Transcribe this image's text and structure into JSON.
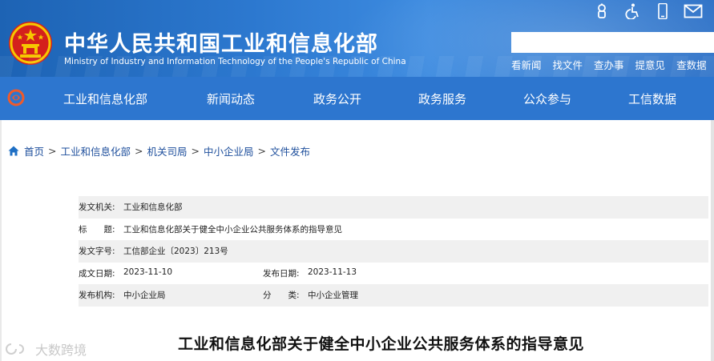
{
  "header": {
    "site_title": "中华人民共和国工业和信息化部",
    "site_subtitle": "Ministry of Industry and Information Technology of the People's Republic of China",
    "top_icons": [
      "robot-icon",
      "accessibility-icon",
      "mobile-icon",
      "mail-icon"
    ],
    "search": {
      "value": "",
      "placeholder": ""
    },
    "quick_links": [
      "看新闻",
      "找文件",
      "查办事",
      "提意见",
      "查数据"
    ]
  },
  "nav": {
    "items": [
      "工业和信息化部",
      "新闻动态",
      "政务公开",
      "政务服务",
      "公众参与",
      "工信数据"
    ]
  },
  "breadcrumb": {
    "items": [
      "首页",
      "工业和信息化部",
      "机关司局",
      "中小企业局",
      "文件发布"
    ],
    "separator": ">"
  },
  "meta": {
    "issuer": {
      "label": "发文机关:",
      "value": "工业和信息化部"
    },
    "title": {
      "label": "标　　题:",
      "value": "工业和信息化部关于健全中小企业公共服务体系的指导意见"
    },
    "doc_number": {
      "label": "发文字号:",
      "value": "工信部企业〔2023〕213号"
    },
    "written_date": {
      "label": "成文日期:",
      "value": "2023-11-10"
    },
    "publish_date": {
      "label": "发布日期:",
      "value": "2023-11-13"
    },
    "publisher": {
      "label": "发布机构:",
      "value": "中小企业局"
    },
    "category": {
      "label": "分　　类:",
      "value": "中小企业管理"
    }
  },
  "document": {
    "title": "工业和信息化部关于健全中小企业公共服务体系的指导意见"
  },
  "watermark": {
    "text": "大数跨境"
  },
  "colors": {
    "header_blue": "#2c78cf",
    "nav_blue": "#2d76cf",
    "emblem_red": "#d4201c",
    "emblem_gold": "#f6c700",
    "link_blue": "#1e4f9c"
  }
}
